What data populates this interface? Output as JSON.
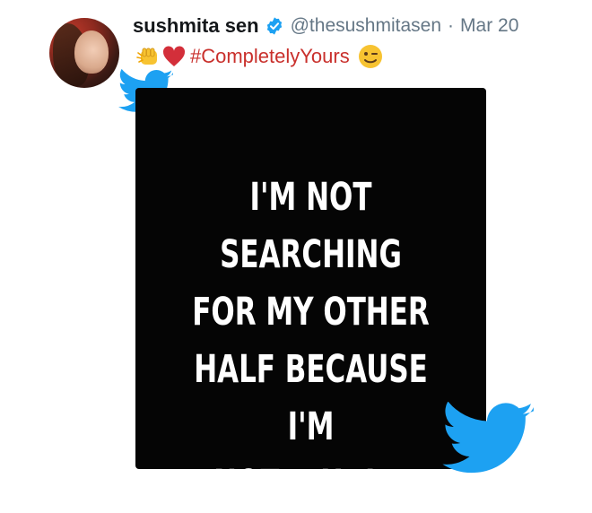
{
  "tweet": {
    "author_name": "sushmita sen",
    "handle": "@thesushmitasen",
    "separator": "·",
    "date": "Mar 20",
    "hashtag": "#CompletelyYours",
    "emojis": [
      "fist-bump-emoji",
      "red-heart-emoji",
      "winking-face-emoji"
    ],
    "verified": true
  },
  "media": {
    "quote_lines": [
      "I'M NOT SEARCHING",
      "FOR MY OTHER",
      "HALF BECAUSE I'M",
      "NOT A HALF."
    ]
  },
  "colors": {
    "twitter_blue": "#1da1f2",
    "hashtag": "#c9302c",
    "meta_grey": "#657786",
    "name": "#14171a",
    "media_bg": "#050505"
  },
  "icons": [
    "verified-badge-icon",
    "twitter-bird-icon"
  ]
}
